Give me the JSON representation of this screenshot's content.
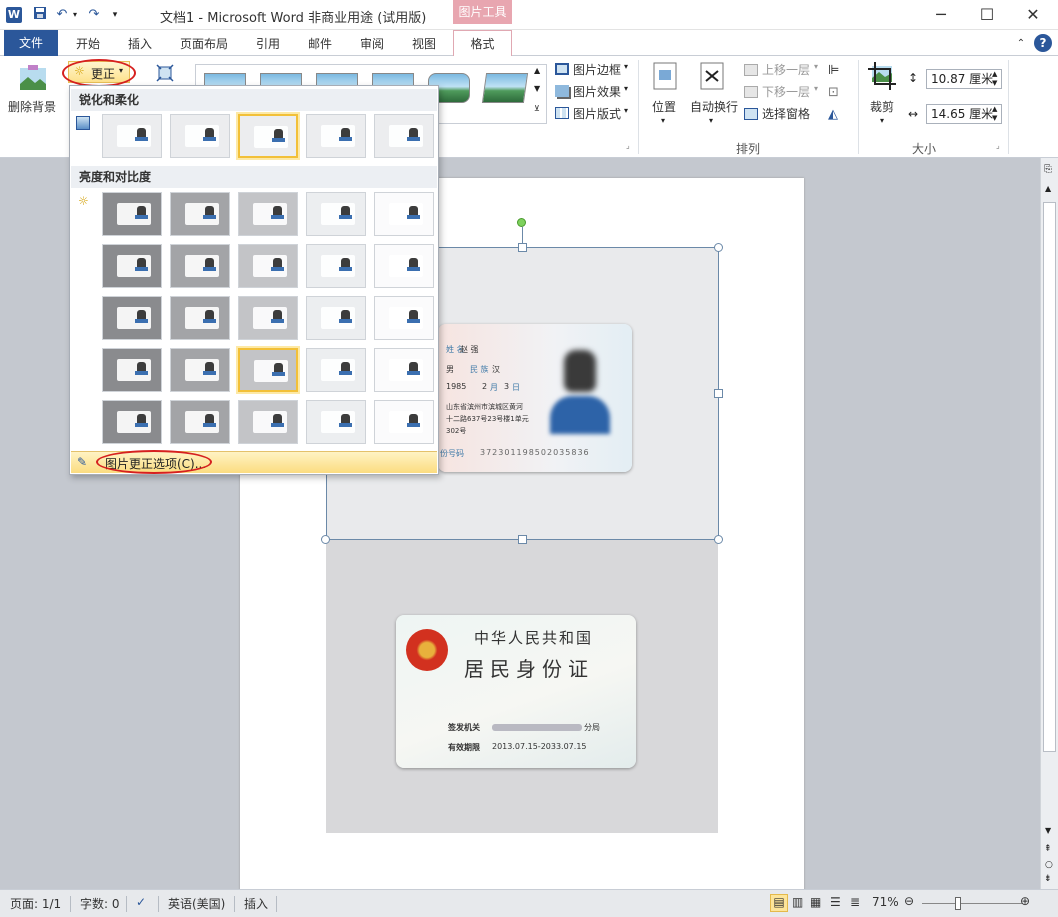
{
  "window": {
    "title": "文档1 - Microsoft Word 非商业用途 (试用版)",
    "context_tab_group": "图片工具",
    "app_icon": "word-icon"
  },
  "tabs": [
    "文件",
    "开始",
    "插入",
    "页面布局",
    "引用",
    "邮件",
    "审阅",
    "视图",
    "格式"
  ],
  "ribbon": {
    "remove_bg": "删除背景",
    "corrections": "更正",
    "picture_border": "图片边框",
    "picture_effects": "图片效果",
    "picture_layout": "图片版式",
    "position": "位置",
    "wrap_text": "自动换行",
    "bring_forward": "上移一层",
    "send_backward": "下移一层",
    "selection_pane": "选择窗格",
    "arrange_group": "排列",
    "crop": "裁剪",
    "height": "10.87 厘米",
    "width": "14.65 厘米",
    "size_group": "大小"
  },
  "dropdown": {
    "sharpen_header": "锐化和柔化",
    "brightness_header": "亮度和对比度",
    "footer_option": "图片更正选项(C)..."
  },
  "card_front": {
    "name_label": "姓 名",
    "name_value": "赵 强",
    "sex_value": "男",
    "ethnic_label": "民 族",
    "ethnic_value": "汉",
    "birth_year": "1985",
    "birth_month": "2",
    "birth_month_label": "月",
    "birth_day": "3",
    "birth_day_label": "日",
    "address_line1": "山东省滨州市滨城区黄河",
    "address_line2": "十二路637号23号楼1单元",
    "address_line3": "302号",
    "id_label": "份号码",
    "id_number": "372301198502035836"
  },
  "card_back": {
    "title_line1": "中华人民共和国",
    "title_line2": "居民身份证",
    "authority_label": "签发机关",
    "authority_suffix": "分局",
    "validity_label": "有效期限",
    "validity_value": "2013.07.15-2033.07.15"
  },
  "statusbar": {
    "page": "页面: 1/1",
    "words": "字数: 0",
    "language": "英语(美国)",
    "mode": "插入",
    "zoom": "71%"
  }
}
